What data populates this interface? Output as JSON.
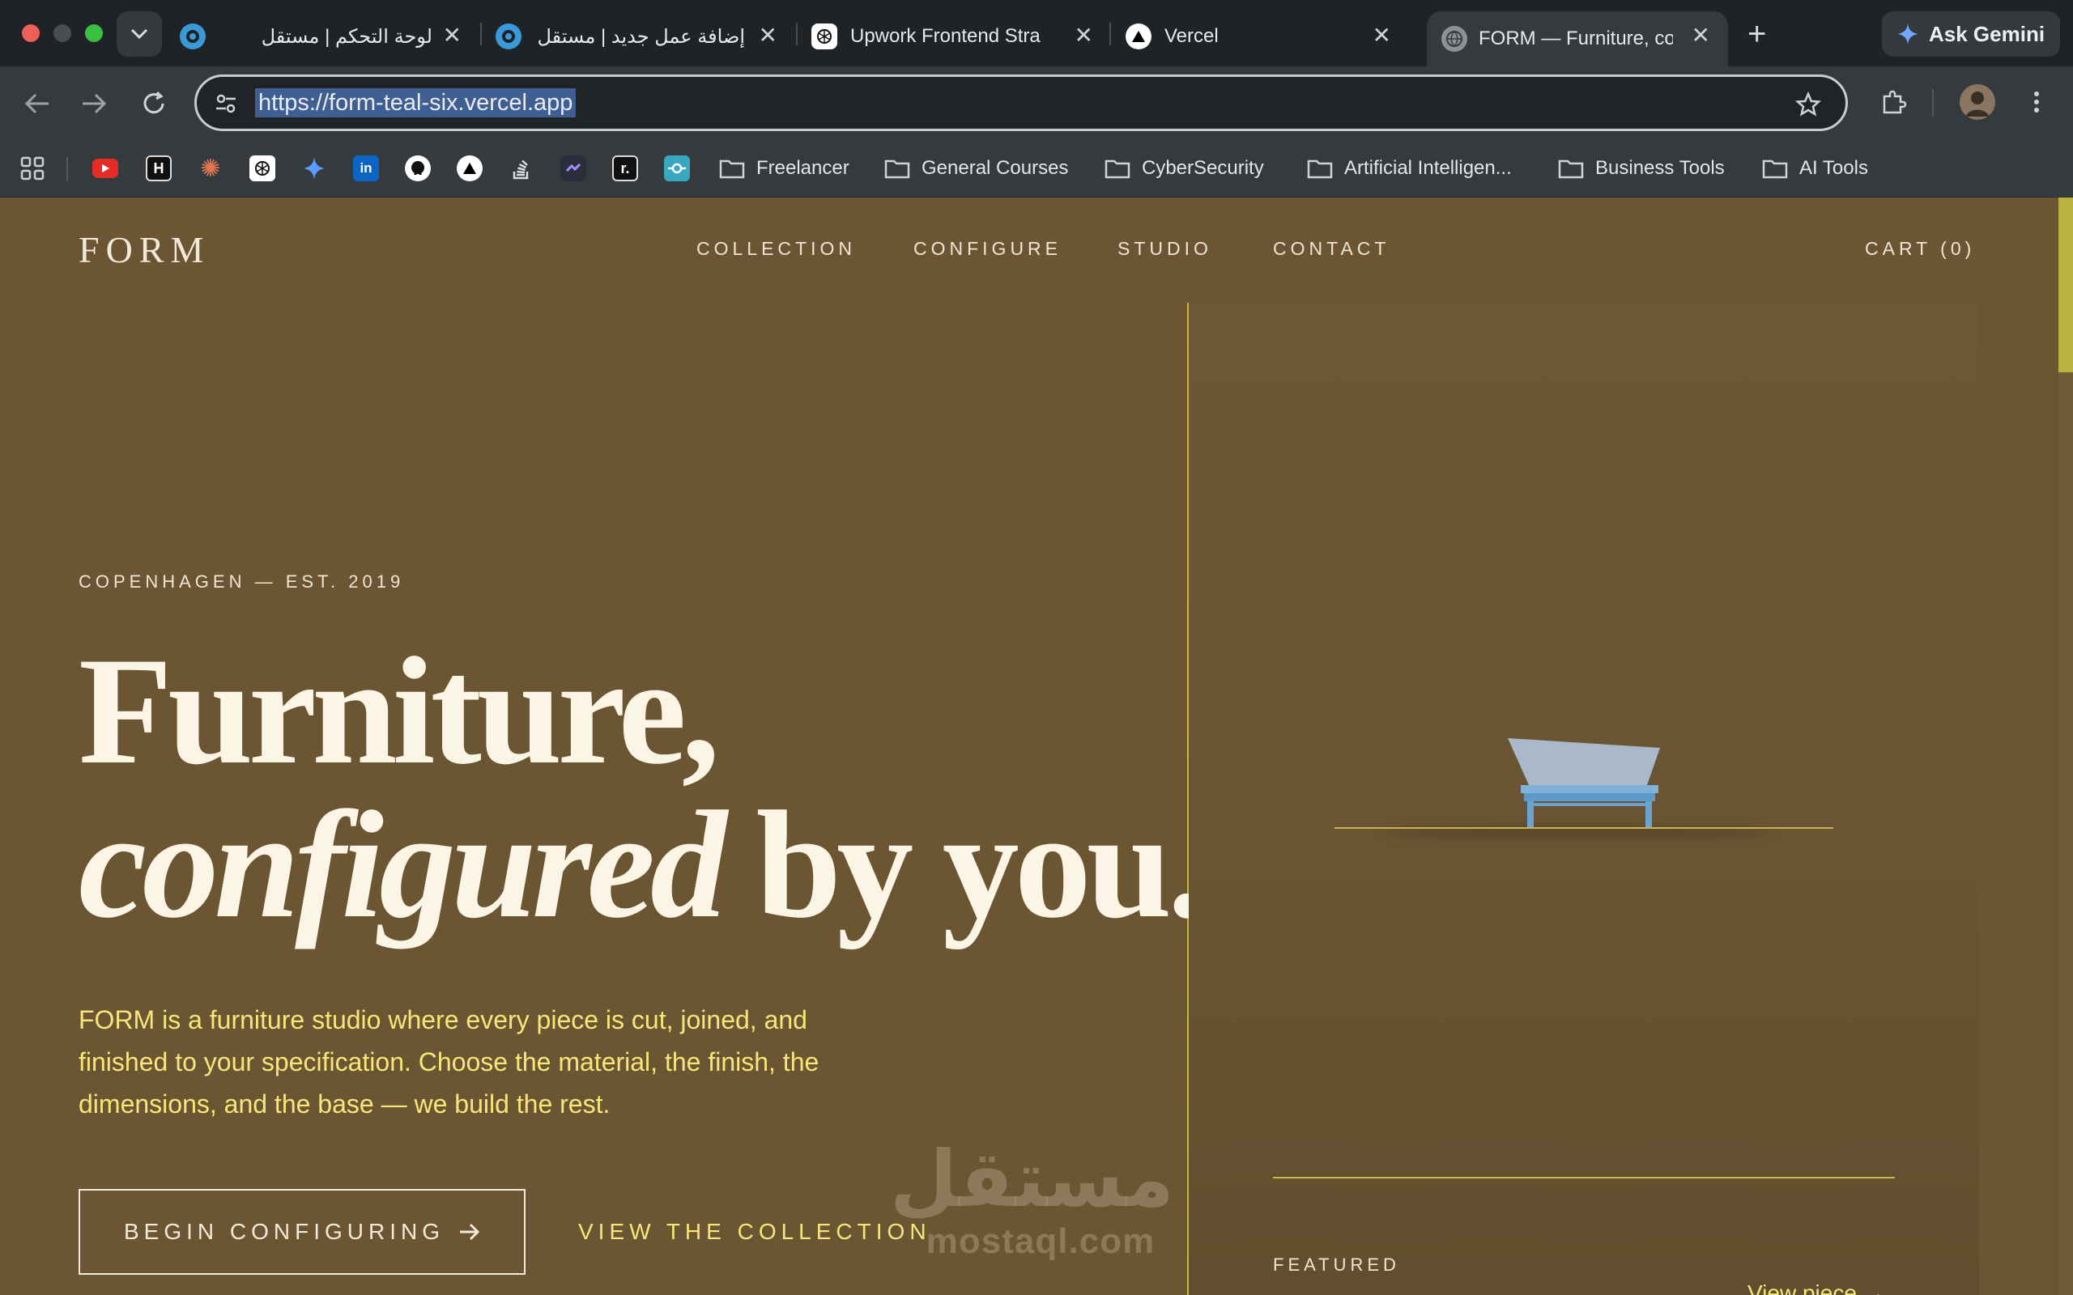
{
  "browser": {
    "tabs": [
      {
        "title": "لوحة التحكم | مستقل",
        "icon": "mostaql-icon"
      },
      {
        "title": "إضافة عمل جديد | مستقل",
        "icon": "mostaql-icon"
      },
      {
        "title": "Upwork Frontend Stra",
        "icon": "openai-icon"
      },
      {
        "title": "Vercel",
        "icon": "vercel-icon"
      },
      {
        "title": "FORM — Furniture, co",
        "icon": "globe-icon",
        "active": true
      }
    ],
    "gemini_label": "Ask Gemini",
    "url": "https://form-teal-six.vercel.app",
    "bookmark_folders": [
      "Freelancer",
      "General Courses",
      "CyberSecurity",
      "Artificial Intelligen...",
      "Business Tools",
      "AI Tools"
    ]
  },
  "site": {
    "logo": "FORM",
    "nav": [
      "COLLECTION",
      "CONFIGURE",
      "STUDIO",
      "CONTACT"
    ],
    "cart": "CART  (0)",
    "eyebrow": "COPENHAGEN — EST. 2019",
    "headline_line1": "Furniture,",
    "headline_em": "configured",
    "headline_rest": " by you.",
    "lede": "FORM is a furniture studio where every piece is cut, joined, and finished to your specification. Choose the material, the finish, the dimensions, and the base — we build the rest.",
    "cta_primary": "BEGIN CONFIGURING",
    "cta_secondary": "VIEW THE COLLECTION",
    "featured_label": "FEATURED",
    "view_piece": "View piece →"
  },
  "watermark": {
    "arabic": "مستقل",
    "latin": "mostaql.com"
  },
  "colors": {
    "page_bg": "#6b5533",
    "accent_yellow": "#f5e77a",
    "cream": "#f2ead8",
    "rule": "#c9b64a"
  }
}
